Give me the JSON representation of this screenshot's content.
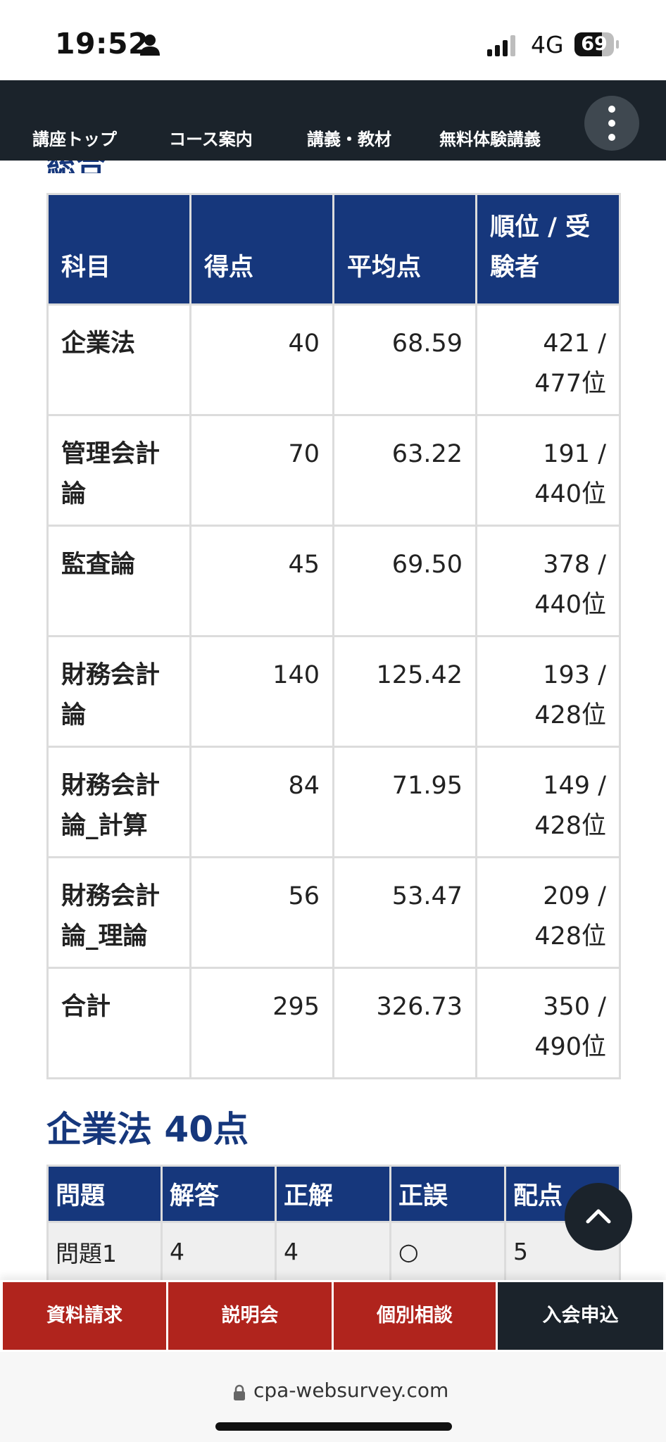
{
  "status_bar": {
    "time": "19:52",
    "network": "4G",
    "battery": "69",
    "battery_level": 0.69
  },
  "nav": {
    "items": [
      "講座トップ",
      "コース案内",
      "講義・教材",
      "無料体験講義"
    ]
  },
  "section_title": "総合",
  "summary": {
    "headers": [
      "科目",
      "得点",
      "平均点",
      "順位 / 受験者"
    ],
    "rows": [
      {
        "subject": "企業法",
        "score": "40",
        "average": "68.59",
        "rank": "421 / 477位"
      },
      {
        "subject": "管理会計論",
        "score": "70",
        "average": "63.22",
        "rank": "191 / 440位"
      },
      {
        "subject": "監査論",
        "score": "45",
        "average": "69.50",
        "rank": "378 / 440位"
      },
      {
        "subject": "財務会計論",
        "score": "140",
        "average": "125.42",
        "rank": "193 / 428位"
      },
      {
        "subject": "財務会計論_計算",
        "score": "84",
        "average": "71.95",
        "rank": "149 / 428位"
      },
      {
        "subject": "財務会計論_理論",
        "score": "56",
        "average": "53.47",
        "rank": "209 / 428位"
      },
      {
        "subject": "合計",
        "score": "295",
        "average": "326.73",
        "rank": "350 / 490位"
      }
    ]
  },
  "subsection": {
    "title": "企業法 40点",
    "headers": [
      "問題",
      "解答",
      "正解",
      "正誤",
      "配点"
    ],
    "rows": [
      {
        "q": "問題1",
        "answer": "4",
        "correct": "4",
        "result": "○",
        "points": "5"
      }
    ]
  },
  "cta": {
    "items": [
      "資料請求",
      "説明会",
      "個別相談",
      "入会申込"
    ]
  },
  "address": {
    "url": "cpa-websurvey.com"
  },
  "colors": {
    "navy": "#16377c",
    "dark": "#1b232b",
    "red": "#b0241d"
  }
}
